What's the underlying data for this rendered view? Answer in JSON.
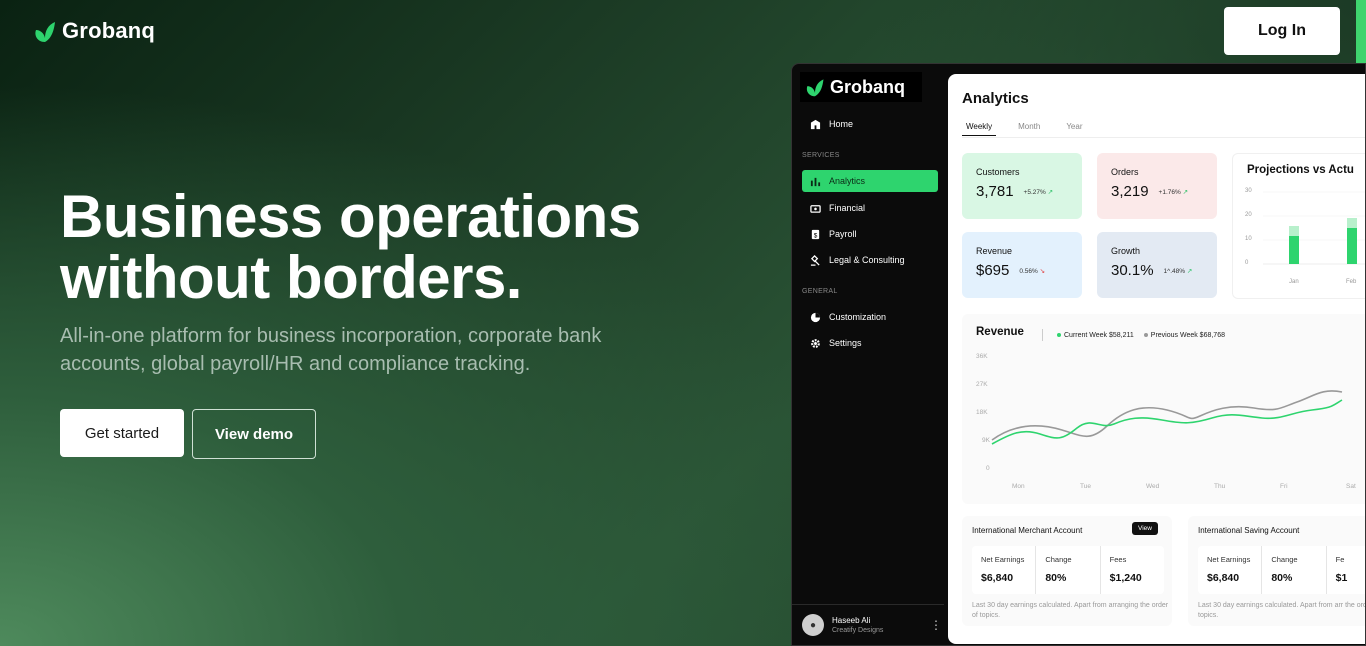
{
  "brand": {
    "name": "Grobanq",
    "accent": "#2ed46e"
  },
  "header": {
    "login_label": "Log In"
  },
  "hero": {
    "title_line1": "Business operations",
    "title_line2": "without borders.",
    "subtitle_line1": "All-in-one platform for business incorporation, corporate bank",
    "subtitle_line2": "accounts, global payroll/HR and compliance tracking.",
    "primary_cta": "Get started",
    "secondary_cta": "View demo"
  },
  "app": {
    "sidebar": {
      "brand": "Grobanq",
      "home": "Home",
      "services_label": "SERVICES",
      "services": [
        "Analytics",
        "Financial",
        "Payroll",
        "Legal & Consulting"
      ],
      "general_label": "GENERAL",
      "general": [
        "Customization",
        "Settings"
      ],
      "user": {
        "name": "Haseeb Ali",
        "company": "Creatify Designs"
      }
    },
    "title": "Analytics",
    "tabs": [
      "Weekly",
      "Month",
      "Year"
    ],
    "cards": [
      {
        "label": "Customers",
        "value": "3,781",
        "change": "+5.27%",
        "trend": "up",
        "color": "#d9f7e4"
      },
      {
        "label": "Orders",
        "value": "3,219",
        "change": "+1.76%",
        "trend": "up",
        "color": "#fbe9e9"
      },
      {
        "label": "Revenue",
        "value": "$695",
        "change": "0.56%",
        "trend": "down",
        "color": "#e3f1fd"
      },
      {
        "label": "Growth",
        "value": "30.1%",
        "change": "1^.48%",
        "trend": "up",
        "color": "#e3eaf3"
      }
    ],
    "projections": {
      "title": "Projections vs Actu",
      "y_ticks": [
        "30",
        "20",
        "10",
        "0"
      ],
      "x_ticks": [
        "Jan",
        "Feb"
      ]
    },
    "revenue": {
      "title": "Revenue",
      "current_label": "Current Week $58,211",
      "previous_label": "Previous Week $68,768",
      "y_ticks": [
        "36K",
        "27K",
        "18K",
        "9K",
        "0"
      ],
      "x_ticks": [
        "Mon",
        "Tue",
        "Wed",
        "Thu",
        "Fri",
        "Sat"
      ]
    },
    "accounts": [
      {
        "title": "International Merchant Account",
        "view": "View",
        "earnings_label": "Net Earnings",
        "earnings": "$6,840",
        "change_label": "Change",
        "change": "80%",
        "fees_label": "Fees",
        "fees": "$1,240",
        "note": "Last 30 day earnings calculated. Apart from arranging the order of topics."
      },
      {
        "title": "International Saving Account",
        "earnings_label": "Net Earnings",
        "earnings": "$6,840",
        "change_label": "Change",
        "change": "80%",
        "fees_label": "Fe",
        "fees": "$1",
        "note": "Last 30 day earnings calculated. Apart from arr the order of topics."
      }
    ]
  }
}
